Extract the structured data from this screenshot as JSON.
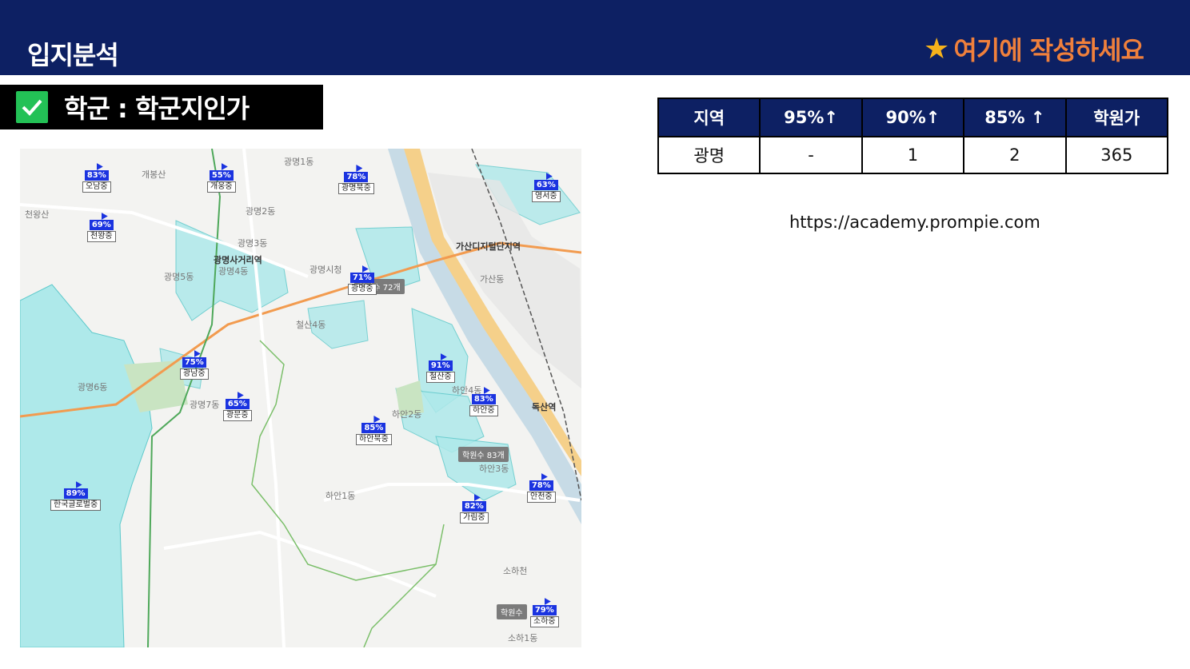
{
  "header": {
    "title": "입지분석",
    "note": "여기에 작성하세요"
  },
  "section": {
    "label": "학군 : 학군지인가"
  },
  "map": {
    "pins": [
      {
        "pct": "83%",
        "school": "오남중"
      },
      {
        "pct": "55%",
        "school": "개웅중"
      },
      {
        "pct": "78%",
        "school": "광명북중"
      },
      {
        "pct": "69%",
        "school": "천왕중"
      },
      {
        "pct": "63%",
        "school": "영서중"
      },
      {
        "pct": "71%",
        "school": "광명중"
      },
      {
        "pct": "75%",
        "school": "광남중"
      },
      {
        "pct": "91%",
        "school": "철산중"
      },
      {
        "pct": "65%",
        "school": "광문중"
      },
      {
        "pct": "83%",
        "school": "하안중"
      },
      {
        "pct": "85%",
        "school": "하안북중"
      },
      {
        "pct": "78%",
        "school": "안천중"
      },
      {
        "pct": "89%",
        "school": "한국글로벌중"
      },
      {
        "pct": "82%",
        "school": "가림중"
      },
      {
        "pct": "79%",
        "school": "소하중"
      }
    ],
    "academies": [
      "학원수 72개",
      "학원수 83개",
      "학원수"
    ],
    "places": [
      "광명1동",
      "광명2동",
      "광명3동",
      "광명4동",
      "광명5동",
      "광명6동",
      "광명7동",
      "광명사거리역",
      "광명시청",
      "철산4동",
      "하안2동",
      "하안3동",
      "하안4동",
      "하안1동",
      "가산동",
      "가산디지털단지역",
      "독산역",
      "소하1동",
      "소하천",
      "개봉산",
      "천왕산"
    ]
  },
  "table": {
    "headers": [
      "지역",
      "95%↑",
      "90%↑",
      "85% ↑",
      "학원가"
    ],
    "rows": [
      [
        "광명",
        "-",
        "1",
        "2",
        "365"
      ]
    ]
  },
  "url": "https://academy.prompie.com"
}
